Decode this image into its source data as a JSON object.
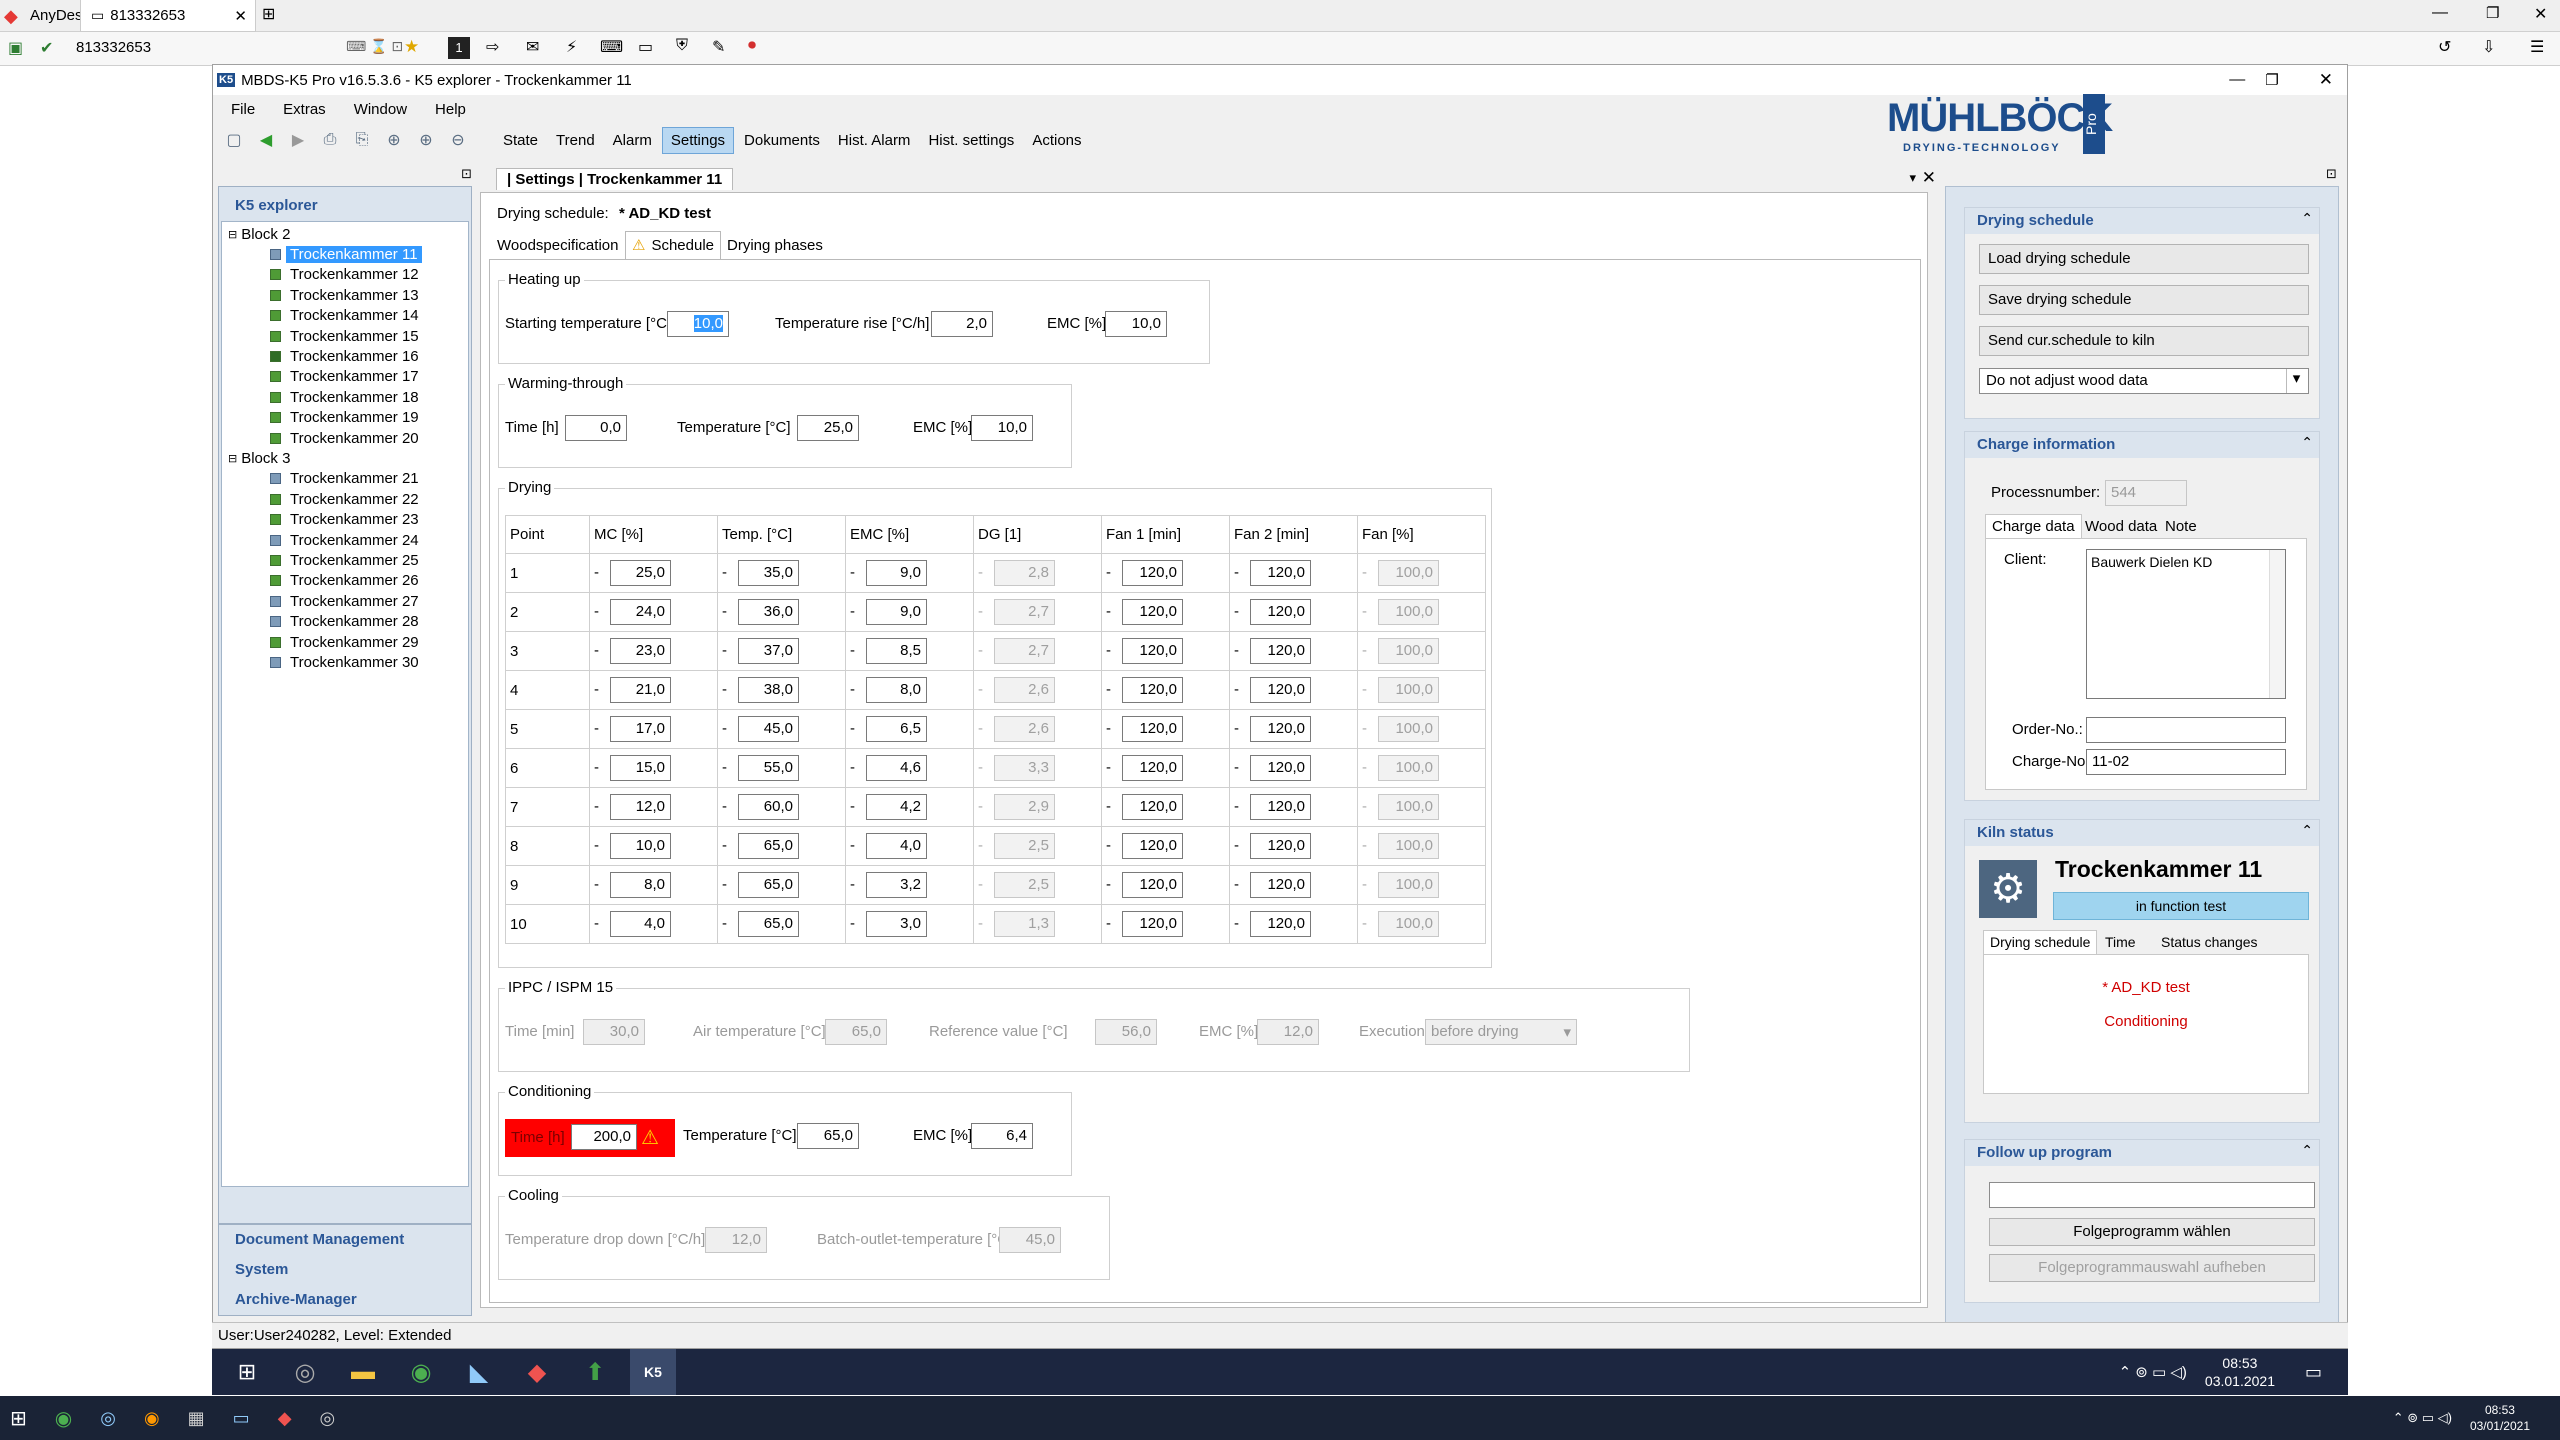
{
  "anydesk": {
    "app_name": "AnyDesk",
    "tab_title": "813332653",
    "address": "813332653"
  },
  "app": {
    "title": "MBDS-K5 Pro v16.5.3.6 - K5 explorer - Trockenkammer 11",
    "menu": [
      "File",
      "Extras",
      "Window",
      "Help"
    ],
    "nav_tabs": [
      "State",
      "Trend",
      "Alarm",
      "Settings",
      "Dokuments",
      "Hist. Alarm",
      "Hist. settings",
      "Actions"
    ],
    "active_tab": "Settings",
    "logo": {
      "brand": "MÜHLBÖCK",
      "sub": "DRYING-TECHNOLOGY",
      "badge": "Pro"
    }
  },
  "explorer": {
    "title": "K5 explorer",
    "groups": [
      {
        "name": "Block 2",
        "items": [
          "Trockenkammer 11",
          "Trockenkammer 12",
          "Trockenkammer 13",
          "Trockenkammer 14",
          "Trockenkammer 15",
          "Trockenkammer 16",
          "Trockenkammer 17",
          "Trockenkammer 18",
          "Trockenkammer 19",
          "Trockenkammer 20"
        ]
      },
      {
        "name": "Block 3",
        "items": [
          "Trockenkammer 21",
          "Trockenkammer 22",
          "Trockenkammer 23",
          "Trockenkammer 24",
          "Trockenkammer 25",
          "Trockenkammer 26",
          "Trockenkammer 27",
          "Trockenkammer 28",
          "Trockenkammer 29",
          "Trockenkammer 30"
        ]
      }
    ],
    "selected": "Trockenkammer 11",
    "bottom_links": [
      "Document Management",
      "System",
      "Archive-Manager"
    ]
  },
  "settings": {
    "tab_title": "| Settings | Trockenkammer 11",
    "schedule_label": "Drying schedule:",
    "schedule_name": "* AD_KD test",
    "subtabs": [
      "Woodspecification",
      "Schedule",
      "Drying phases"
    ],
    "active_subtab": "Schedule",
    "heating_up": {
      "label": "Heating up",
      "start_temp_label": "Starting temperature [°C]",
      "start_temp": "10,0",
      "temp_rise_label": "Temperature rise [°C/h]",
      "temp_rise": "2,0",
      "emc_label": "EMC [%]",
      "emc": "10,0"
    },
    "warming_through": {
      "label": "Warming-through",
      "time_label": "Time [h]",
      "time": "0,0",
      "temp_label": "Temperature [°C]",
      "temp": "25,0",
      "emc_label": "EMC [%]",
      "emc": "10,0"
    },
    "drying": {
      "label": "Drying",
      "columns": [
        "Point",
        "MC [%]",
        "Temp. [°C]",
        "EMC [%]",
        "DG [1]",
        "Fan 1 [min]",
        "Fan 2 [min]",
        "Fan [%]"
      ],
      "rows": [
        [
          "1",
          "25,0",
          "35,0",
          "9,0",
          "2,8",
          "120,0",
          "120,0",
          "100,0"
        ],
        [
          "2",
          "24,0",
          "36,0",
          "9,0",
          "2,7",
          "120,0",
          "120,0",
          "100,0"
        ],
        [
          "3",
          "23,0",
          "37,0",
          "8,5",
          "2,7",
          "120,0",
          "120,0",
          "100,0"
        ],
        [
          "4",
          "21,0",
          "38,0",
          "8,0",
          "2,6",
          "120,0",
          "120,0",
          "100,0"
        ],
        [
          "5",
          "17,0",
          "45,0",
          "6,5",
          "2,6",
          "120,0",
          "120,0",
          "100,0"
        ],
        [
          "6",
          "15,0",
          "55,0",
          "4,6",
          "3,3",
          "120,0",
          "120,0",
          "100,0"
        ],
        [
          "7",
          "12,0",
          "60,0",
          "4,2",
          "2,9",
          "120,0",
          "120,0",
          "100,0"
        ],
        [
          "8",
          "10,0",
          "65,0",
          "4,0",
          "2,5",
          "120,0",
          "120,0",
          "100,0"
        ],
        [
          "9",
          "8,0",
          "65,0",
          "3,2",
          "2,5",
          "120,0",
          "120,0",
          "100,0"
        ],
        [
          "10",
          "4,0",
          "65,0",
          "3,0",
          "1,3",
          "120,0",
          "120,0",
          "100,0"
        ]
      ]
    },
    "ippc": {
      "label": "IPPC / ISPM 15",
      "time_label": "Time [min]",
      "time": "30,0",
      "air_temp_label": "Air temperature [°C]",
      "air_temp": "65,0",
      "ref_label": "Reference value [°C]",
      "ref": "56,0",
      "emc_label": "EMC [%]",
      "emc": "12,0",
      "exec_label": "Execution",
      "exec": "before drying"
    },
    "conditioning": {
      "label": "Conditioning",
      "time_label": "Time [h]",
      "time": "200,0",
      "temp_label": "Temperature [°C]",
      "temp": "65,0",
      "emc_label": "EMC [%]",
      "emc": "6,4"
    },
    "cooling": {
      "label": "Cooling",
      "drop_label": "Temperature drop down [°C/h]",
      "drop": "12,0",
      "outlet_label": "Batch-outlet-temperature [°C]",
      "outlet": "45,0"
    }
  },
  "right": {
    "drying_schedule": {
      "title": "Drying schedule",
      "load": "Load drying schedule",
      "save": "Save drying schedule",
      "send": "Send cur.schedule to kiln",
      "select": "Do not adjust wood data"
    },
    "charge": {
      "title": "Charge information",
      "process_label": "Processnumber:",
      "process": "544",
      "tabs": [
        "Charge data",
        "Wood data",
        "Note"
      ],
      "client_label": "Client:",
      "client": "Bauwerk  Dielen  KD",
      "order_label": "Order-No.:",
      "order": "",
      "charge_label": "Charge-No.:",
      "charge": "11-02"
    },
    "kiln": {
      "title": "Kiln status",
      "name": "Trockenkammer 11",
      "state": "in function test",
      "tabs": [
        "Drying schedule",
        "Time",
        "Status changes"
      ],
      "schedule": "* AD_KD test",
      "phase": "Conditioning"
    },
    "follow": {
      "title": "Follow up program",
      "choose": "Folgeprogramm wählen",
      "cancel": "Folgeprogrammauswahl aufheben"
    }
  },
  "status_bar": "User:User240282, Level: Extended",
  "remote_clock": {
    "time": "08:53",
    "date": "03.01.2021"
  },
  "local_clock": {
    "time": "08:53",
    "date": "03/01/2021"
  },
  "colors": {
    "accent": "#2b5797",
    "alarm": "#ff0000",
    "selected": "#3399ff"
  }
}
